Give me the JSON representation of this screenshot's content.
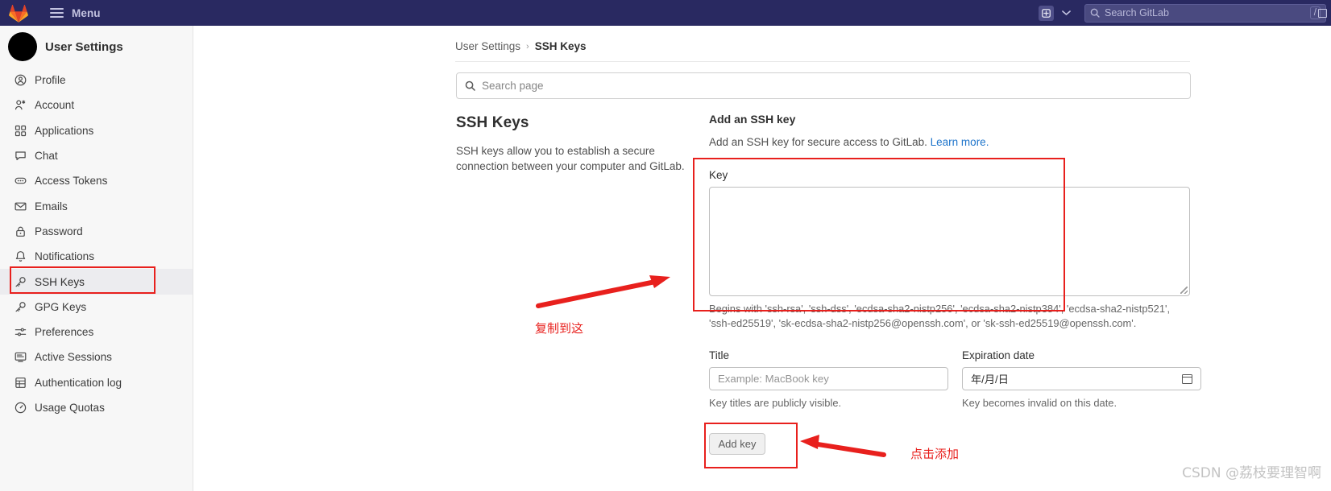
{
  "navbar": {
    "logo_icon": "gitlab-logo-icon",
    "menu_label": "Menu",
    "hamburger_icon": "hamburger-menu-icon",
    "plus_icon": "plus-square-icon",
    "caret_icon": "chevron-down-icon",
    "search_icon": "search-icon",
    "search_placeholder": "Search GitLab",
    "search_shortcut": "/",
    "far_right_icon": "panel-toggle-icon",
    "bg_color": "#292961"
  },
  "sidebar": {
    "title": "User Settings",
    "avatar_icon": "user-avatar",
    "items": [
      {
        "label": "Profile",
        "icon": "user-circle-icon",
        "active": false
      },
      {
        "label": "Account",
        "icon": "account-key-icon",
        "active": false
      },
      {
        "label": "Applications",
        "icon": "applications-grid-icon",
        "active": false
      },
      {
        "label": "Chat",
        "icon": "chat-bubble-icon",
        "active": false
      },
      {
        "label": "Access Tokens",
        "icon": "token-icon",
        "active": false
      },
      {
        "label": "Emails",
        "icon": "envelope-icon",
        "active": false
      },
      {
        "label": "Password",
        "icon": "lock-icon",
        "active": false
      },
      {
        "label": "Notifications",
        "icon": "bell-icon",
        "active": false
      },
      {
        "label": "SSH Keys",
        "icon": "key-icon",
        "active": true
      },
      {
        "label": "GPG Keys",
        "icon": "key-icon",
        "active": false
      },
      {
        "label": "Preferences",
        "icon": "sliders-icon",
        "active": false
      },
      {
        "label": "Active Sessions",
        "icon": "monitor-icon",
        "active": false
      },
      {
        "label": "Authentication log",
        "icon": "log-table-icon",
        "active": false
      },
      {
        "label": "Usage Quotas",
        "icon": "gauge-icon",
        "active": false
      }
    ]
  },
  "breadcrumb": {
    "parent": "User Settings",
    "separator": "›",
    "current": "SSH Keys"
  },
  "page_search": {
    "icon": "search-icon",
    "placeholder": "Search page"
  },
  "left_panel": {
    "heading": "SSH Keys",
    "description": "SSH keys allow you to establish a secure connection between your computer and GitLab."
  },
  "form": {
    "heading": "Add an SSH key",
    "subtitle_text": "Add an SSH key for secure access to GitLab.",
    "subtitle_link": "Learn more.",
    "key_label": "Key",
    "key_value": "",
    "key_help": "Begins with 'ssh-rsa', 'ssh-dss', 'ecdsa-sha2-nistp256', 'ecdsa-sha2-nistp384', 'ecdsa-sha2-nistp521', 'ssh-ed25519', 'sk-ecdsa-sha2-nistp256@openssh.com', or 'sk-ssh-ed25519@openssh.com'.",
    "title_label": "Title",
    "title_placeholder": "Example: MacBook key",
    "title_value": "",
    "title_hint": "Key titles are publicly visible.",
    "expiration_label": "Expiration date",
    "expiration_value": "年/月/日",
    "expiration_hint": "Key becomes invalid on this date.",
    "calendar_icon": "calendar-icon",
    "submit_label": "Add key"
  },
  "annotations": {
    "color": "#e8201d",
    "copy_here_text": "复制到这",
    "click_add_text": "点击添加"
  },
  "watermark": "CSDN @荔枝要理智啊"
}
